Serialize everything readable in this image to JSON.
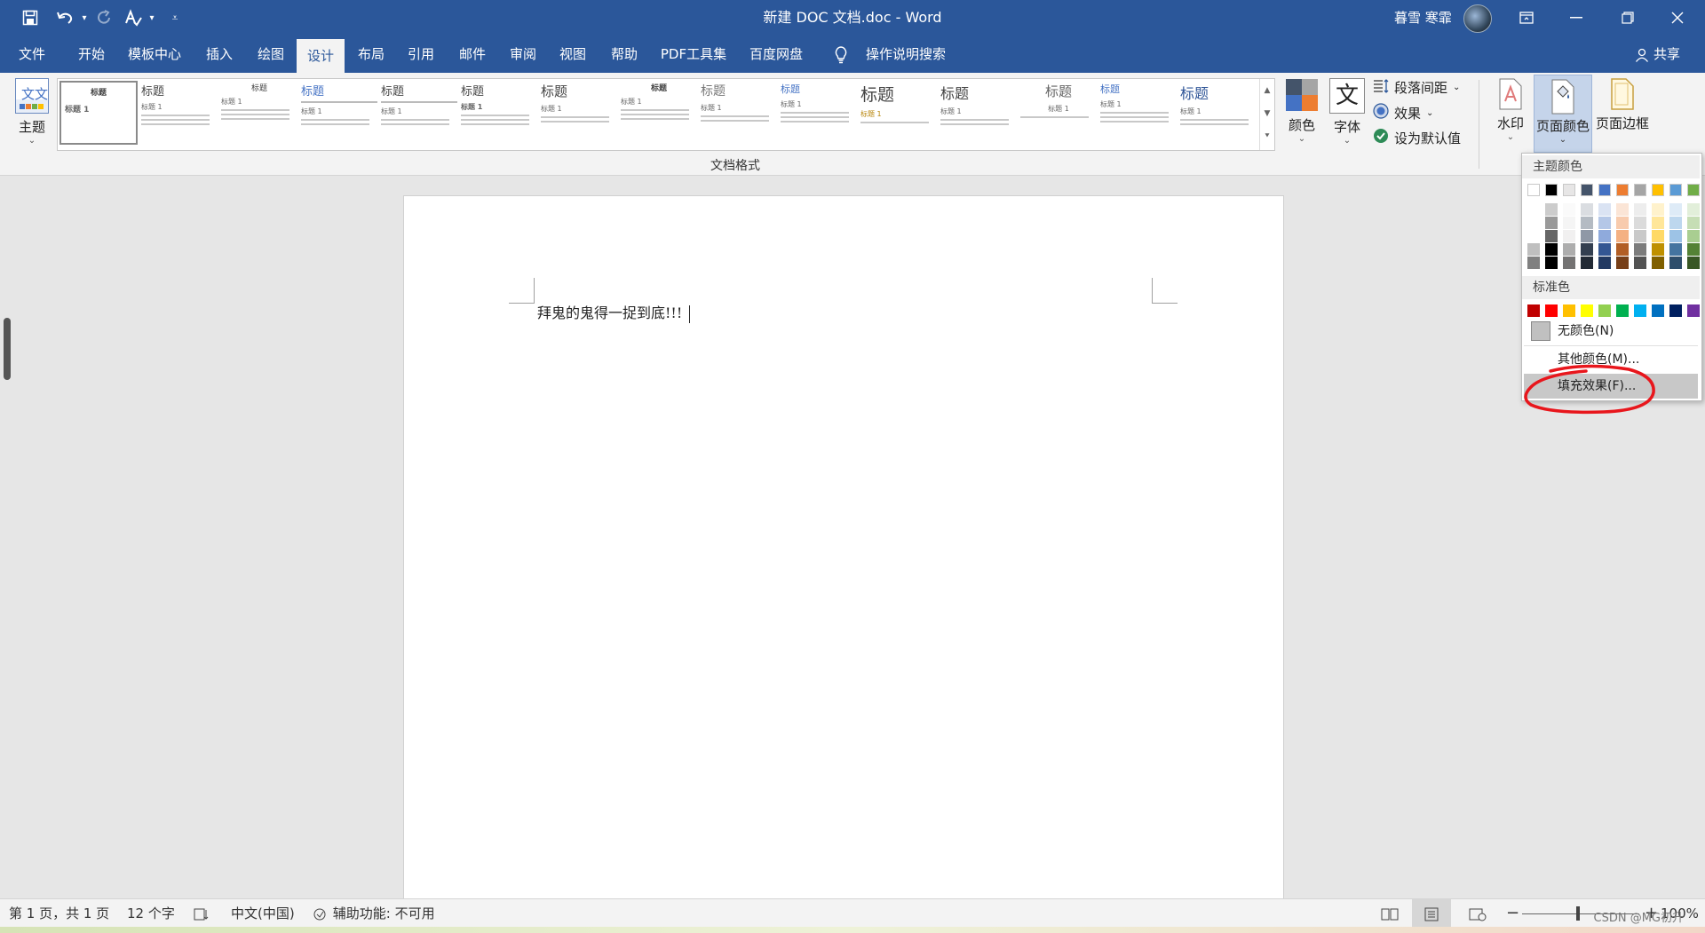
{
  "window": {
    "title": "新建 DOC 文档.doc  -  Word",
    "user_name": "暮雪 寒霏",
    "quick_access": [
      "save-icon",
      "undo-icon",
      "redo-icon",
      "spelling-icon",
      "customize-icon"
    ]
  },
  "tabs": [
    "文件",
    "开始",
    "模板中心",
    "插入",
    "绘图",
    "设计",
    "布局",
    "引用",
    "邮件",
    "审阅",
    "视图",
    "帮助",
    "PDF工具集",
    "百度网盘"
  ],
  "active_tab": "设计",
  "search_label": "操作说明搜索",
  "share_label": "共享",
  "ribbon": {
    "theme_label": "主题",
    "group_label": "文档格式",
    "colors_label": "颜色",
    "fonts_label": "字体",
    "paragraph_spacing_label": "段落间距",
    "effects_label": "效果",
    "set_default_label": "设为默认值",
    "watermark_label": "水印",
    "page_color_label": "页面颜色",
    "page_borders_label": "页面边框",
    "style_titles": [
      "标题",
      "标题",
      "标题",
      "标题",
      "标题",
      "标题",
      "标题",
      "标题",
      "标题",
      "标题",
      "标题",
      "标题",
      "标题",
      "标题",
      "标题"
    ],
    "style_heading1": "标题 1"
  },
  "document": {
    "text": "拜鬼的鬼得一捉到底!!!"
  },
  "color_menu": {
    "theme_colors_label": "主题颜色",
    "standard_colors_label": "标准色",
    "no_color_label": "无颜色(N)",
    "more_colors_label": "其他颜色(M)...",
    "fill_effects_label": "填充效果(F)...",
    "theme_colors": [
      "#ffffff",
      "#000000",
      "#e7e6e6",
      "#44546a",
      "#4472c4",
      "#ed7d31",
      "#a5a5a5",
      "#ffc000",
      "#5b9bd5",
      "#70ad47"
    ],
    "standard_colors": [
      "#c00000",
      "#ff0000",
      "#ffc000",
      "#ffff00",
      "#92d050",
      "#00b050",
      "#00b0f0",
      "#0070c0",
      "#002060",
      "#7030a0"
    ]
  },
  "status_bar": {
    "page": "第 1 页，共 1 页",
    "word_count": "12 个字",
    "language": "中文(中国)",
    "accessibility": "辅助功能: 不可用",
    "zoom": "100%"
  },
  "watermark_text": "CSDN @MG初升"
}
